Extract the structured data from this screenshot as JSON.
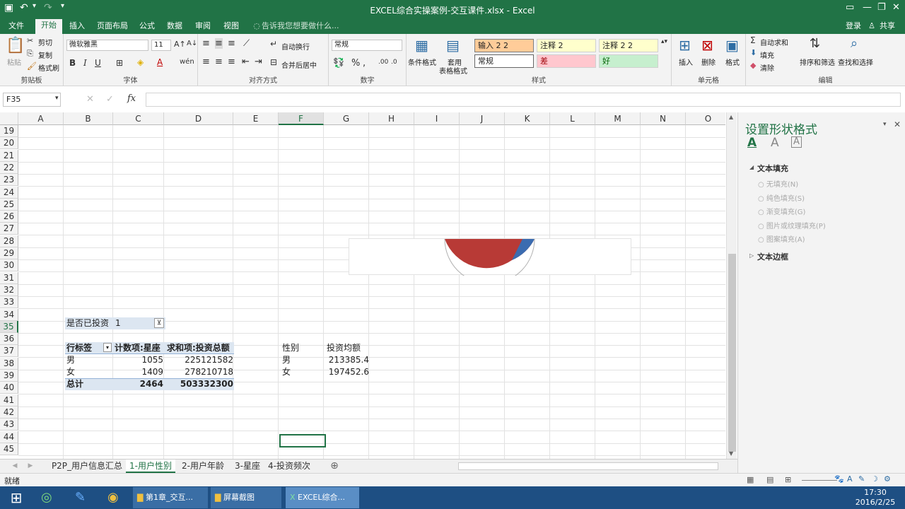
{
  "window": {
    "title": "EXCEL综合实操案例-交互课件.xlsx - Excel"
  },
  "ribbon_tabs": [
    "文件",
    "开始",
    "插入",
    "页面布局",
    "公式",
    "数据",
    "审阅",
    "视图"
  ],
  "tellme": "告诉我您想要做什么...",
  "account": {
    "login": "登录",
    "share": "共享"
  },
  "clipboard": {
    "paste": "粘贴",
    "cut": "剪切",
    "copy": "复制",
    "format_painter": "格式刷",
    "label": "剪贴板"
  },
  "font": {
    "name": "微软雅黑",
    "size": "11",
    "label": "字体"
  },
  "alignment": {
    "wrap": "自动换行",
    "merge": "合并后居中",
    "label": "对齐方式"
  },
  "number": {
    "format": "常规",
    "label": "数字"
  },
  "styles": {
    "cond": "条件格式",
    "table": "套用",
    "table2": "表格格式",
    "label": "样式",
    "cells": [
      "输入 2 2",
      "注释 2",
      "注释 2 2",
      "常规",
      "差",
      "好"
    ]
  },
  "cells_group": {
    "insert": "插入",
    "delete": "删除",
    "format": "格式",
    "label": "单元格"
  },
  "editing": {
    "autosum": "自动求和",
    "fill": "填充",
    "clear": "清除",
    "sort": "排序和筛选",
    "find": "查找和选择",
    "label": "编辑"
  },
  "formula_bar": {
    "name_box": "F35",
    "fx": "fx"
  },
  "columns": [
    "A",
    "B",
    "C",
    "D",
    "E",
    "F",
    "G",
    "H",
    "I",
    "J",
    "K",
    "L",
    "M",
    "N",
    "O"
  ],
  "rows": [
    "19",
    "20",
    "21",
    "22",
    "23",
    "24",
    "25",
    "26",
    "27",
    "28",
    "29",
    "30",
    "31",
    "32",
    "33",
    "34",
    "35",
    "36",
    "37",
    "38",
    "39",
    "40",
    "41",
    "42",
    "43",
    "44",
    "45"
  ],
  "pivot": {
    "filter_label": "是否已投资",
    "filter_value": "1",
    "headers": [
      "行标签",
      "计数项:星座",
      "求和项:投资总额"
    ],
    "rows": [
      [
        "男",
        "1055",
        "225121582"
      ],
      [
        "女",
        "1409",
        "278210718"
      ]
    ],
    "total": [
      "总计",
      "2464",
      "503332300"
    ]
  },
  "avg_table": {
    "headers": [
      "性别",
      "投资均额"
    ],
    "rows": [
      [
        "男",
        "213385.4"
      ],
      [
        "女",
        "197452.6"
      ]
    ]
  },
  "format_pane": {
    "title": "设置形状格式",
    "fill_section": "文本填充",
    "options": [
      "无填充(N)",
      "纯色填充(S)",
      "渐变填充(G)",
      "图片或纹理填充(P)",
      "图案填充(A)"
    ],
    "border_section": "文本边框"
  },
  "sheet_tabs": [
    "P2P_用户信息汇总",
    "1-用户性别",
    "2-用户年龄",
    "3-星座",
    "4-投资频次"
  ],
  "status": {
    "ready": "就绪"
  },
  "taskbar": {
    "items": [
      "第1章_交互...",
      "屏幕截图",
      "EXCEL综合..."
    ],
    "time": "17:30",
    "date": "2016/2/25"
  },
  "colors": {
    "excel_green": "#217346",
    "pivot_header": "#dce6f1"
  }
}
